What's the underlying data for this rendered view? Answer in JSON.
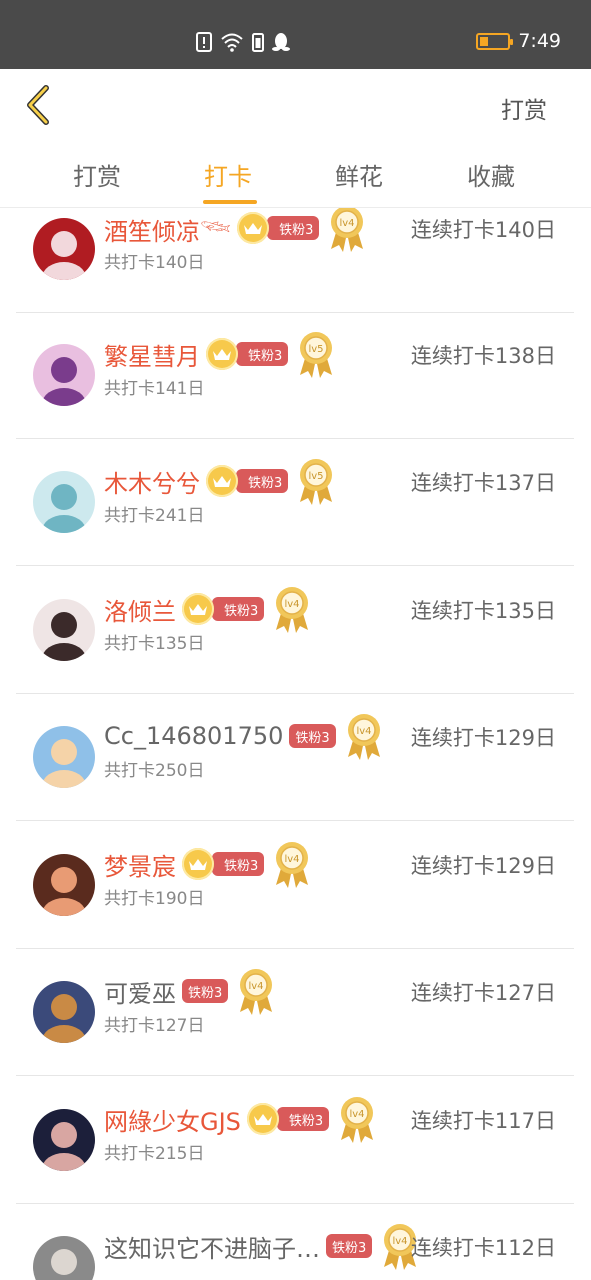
{
  "status_bar": {
    "time": "7:49",
    "icons": [
      "alert-icon",
      "wifi-icon",
      "sim-icon",
      "qq-penguin-icon"
    ]
  },
  "header": {
    "back_icon": "chevron-left-icon",
    "right_action": "打赏"
  },
  "tabs": [
    {
      "label": "打赏",
      "active": false
    },
    {
      "label": "打卡",
      "active": true
    },
    {
      "label": "鲜花",
      "active": false
    },
    {
      "label": "收藏",
      "active": false
    }
  ],
  "colors": {
    "accent": "#f5a623",
    "name_highlight": "#e8573a",
    "fan_badge": "#d95a5a",
    "status_bar": "#4a4a4a"
  },
  "list": [
    {
      "name": "酒笙倾凉𓆝",
      "vip": true,
      "fan": "铁粉3",
      "level": "lv4",
      "total": "共打卡140日",
      "streak": "连续打卡140日"
    },
    {
      "name": "繁星彗月",
      "vip": true,
      "fan": "铁粉3",
      "level": "lv5",
      "total": "共打卡141日",
      "streak": "连续打卡138日"
    },
    {
      "name": "木木兮兮",
      "vip": true,
      "fan": "铁粉3",
      "level": "lv5",
      "total": "共打卡241日",
      "streak": "连续打卡137日"
    },
    {
      "name": "洛倾兰",
      "vip": true,
      "fan": "铁粉3",
      "level": "lv4",
      "total": "共打卡135日",
      "streak": "连续打卡135日"
    },
    {
      "name": "Cc_146801750",
      "vip": false,
      "fan": "铁粉3",
      "level": "lv4",
      "total": "共打卡250日",
      "streak": "连续打卡129日"
    },
    {
      "name": "梦景宸",
      "vip": true,
      "fan": "铁粉3",
      "level": "lv4",
      "total": "共打卡190日",
      "streak": "连续打卡129日"
    },
    {
      "name": "可爱巫",
      "vip": false,
      "fan": "铁粉3",
      "level": "lv4",
      "total": "共打卡127日",
      "streak": "连续打卡127日"
    },
    {
      "name": "网綠少女GJS",
      "vip": true,
      "fan": "铁粉3",
      "level": "lv4",
      "total": "共打卡215日",
      "streak": "连续打卡117日"
    },
    {
      "name": "这知识它不进脑子…",
      "vip": false,
      "fan": "铁粉3",
      "level": "lv4",
      "total": "",
      "streak": "连续打卡112日"
    }
  ]
}
